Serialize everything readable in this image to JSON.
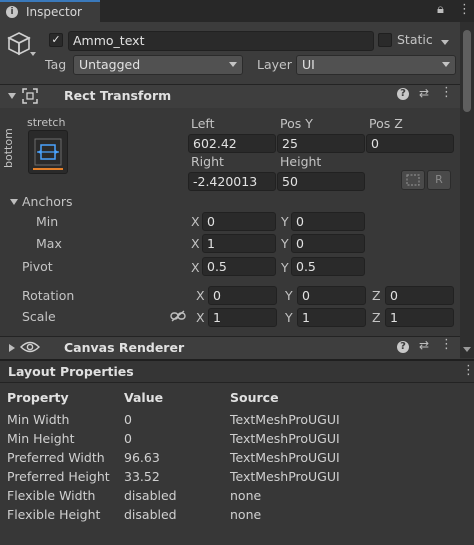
{
  "tab": {
    "icon": "info-icon",
    "label": "Inspector"
  },
  "gameobject": {
    "active_checked": true,
    "name": "Ammo_text",
    "static_label": "Static",
    "tag_label": "Tag",
    "tag_value": "Untagged",
    "layer_label": "Layer",
    "layer_value": "UI"
  },
  "rect_transform": {
    "title": "Rect Transform",
    "anchor_preset_top": "stretch",
    "anchor_preset_side": "bottom",
    "col1_label": "Left",
    "col2_label": "Pos Y",
    "col3_label": "Pos Z",
    "left": "602.42",
    "pos_y": "25",
    "pos_z": "0",
    "right_label": "Right",
    "height_label": "Height",
    "right": "-2.420013",
    "height": "50",
    "raw_button": "R",
    "anchors_label": "Anchors",
    "min_label": "Min",
    "min_x": "0",
    "min_y": "0",
    "max_label": "Max",
    "max_x": "1",
    "max_y": "0",
    "pivot_label": "Pivot",
    "pivot_x": "0.5",
    "pivot_y": "0.5",
    "rotation_label": "Rotation",
    "rot_x": "0",
    "rot_y": "0",
    "rot_z": "0",
    "scale_label": "Scale",
    "scale_x": "1",
    "scale_y": "1",
    "scale_z": "1",
    "x": "X",
    "y": "Y",
    "z": "Z"
  },
  "canvas_renderer": {
    "title": "Canvas Renderer"
  },
  "layout_properties": {
    "title": "Layout Properties",
    "headers": {
      "property": "Property",
      "value": "Value",
      "source": "Source"
    },
    "rows": [
      {
        "property": "Min Width",
        "value": "0",
        "source": "TextMeshProUGUI"
      },
      {
        "property": "Min Height",
        "value": "0",
        "source": "TextMeshProUGUI"
      },
      {
        "property": "Preferred Width",
        "value": "96.63",
        "source": "TextMeshProUGUI"
      },
      {
        "property": "Preferred Height",
        "value": "33.52",
        "source": "TextMeshProUGUI"
      },
      {
        "property": "Flexible Width",
        "value": "disabled",
        "source": "none"
      },
      {
        "property": "Flexible Height",
        "value": "disabled",
        "source": "none"
      }
    ]
  }
}
